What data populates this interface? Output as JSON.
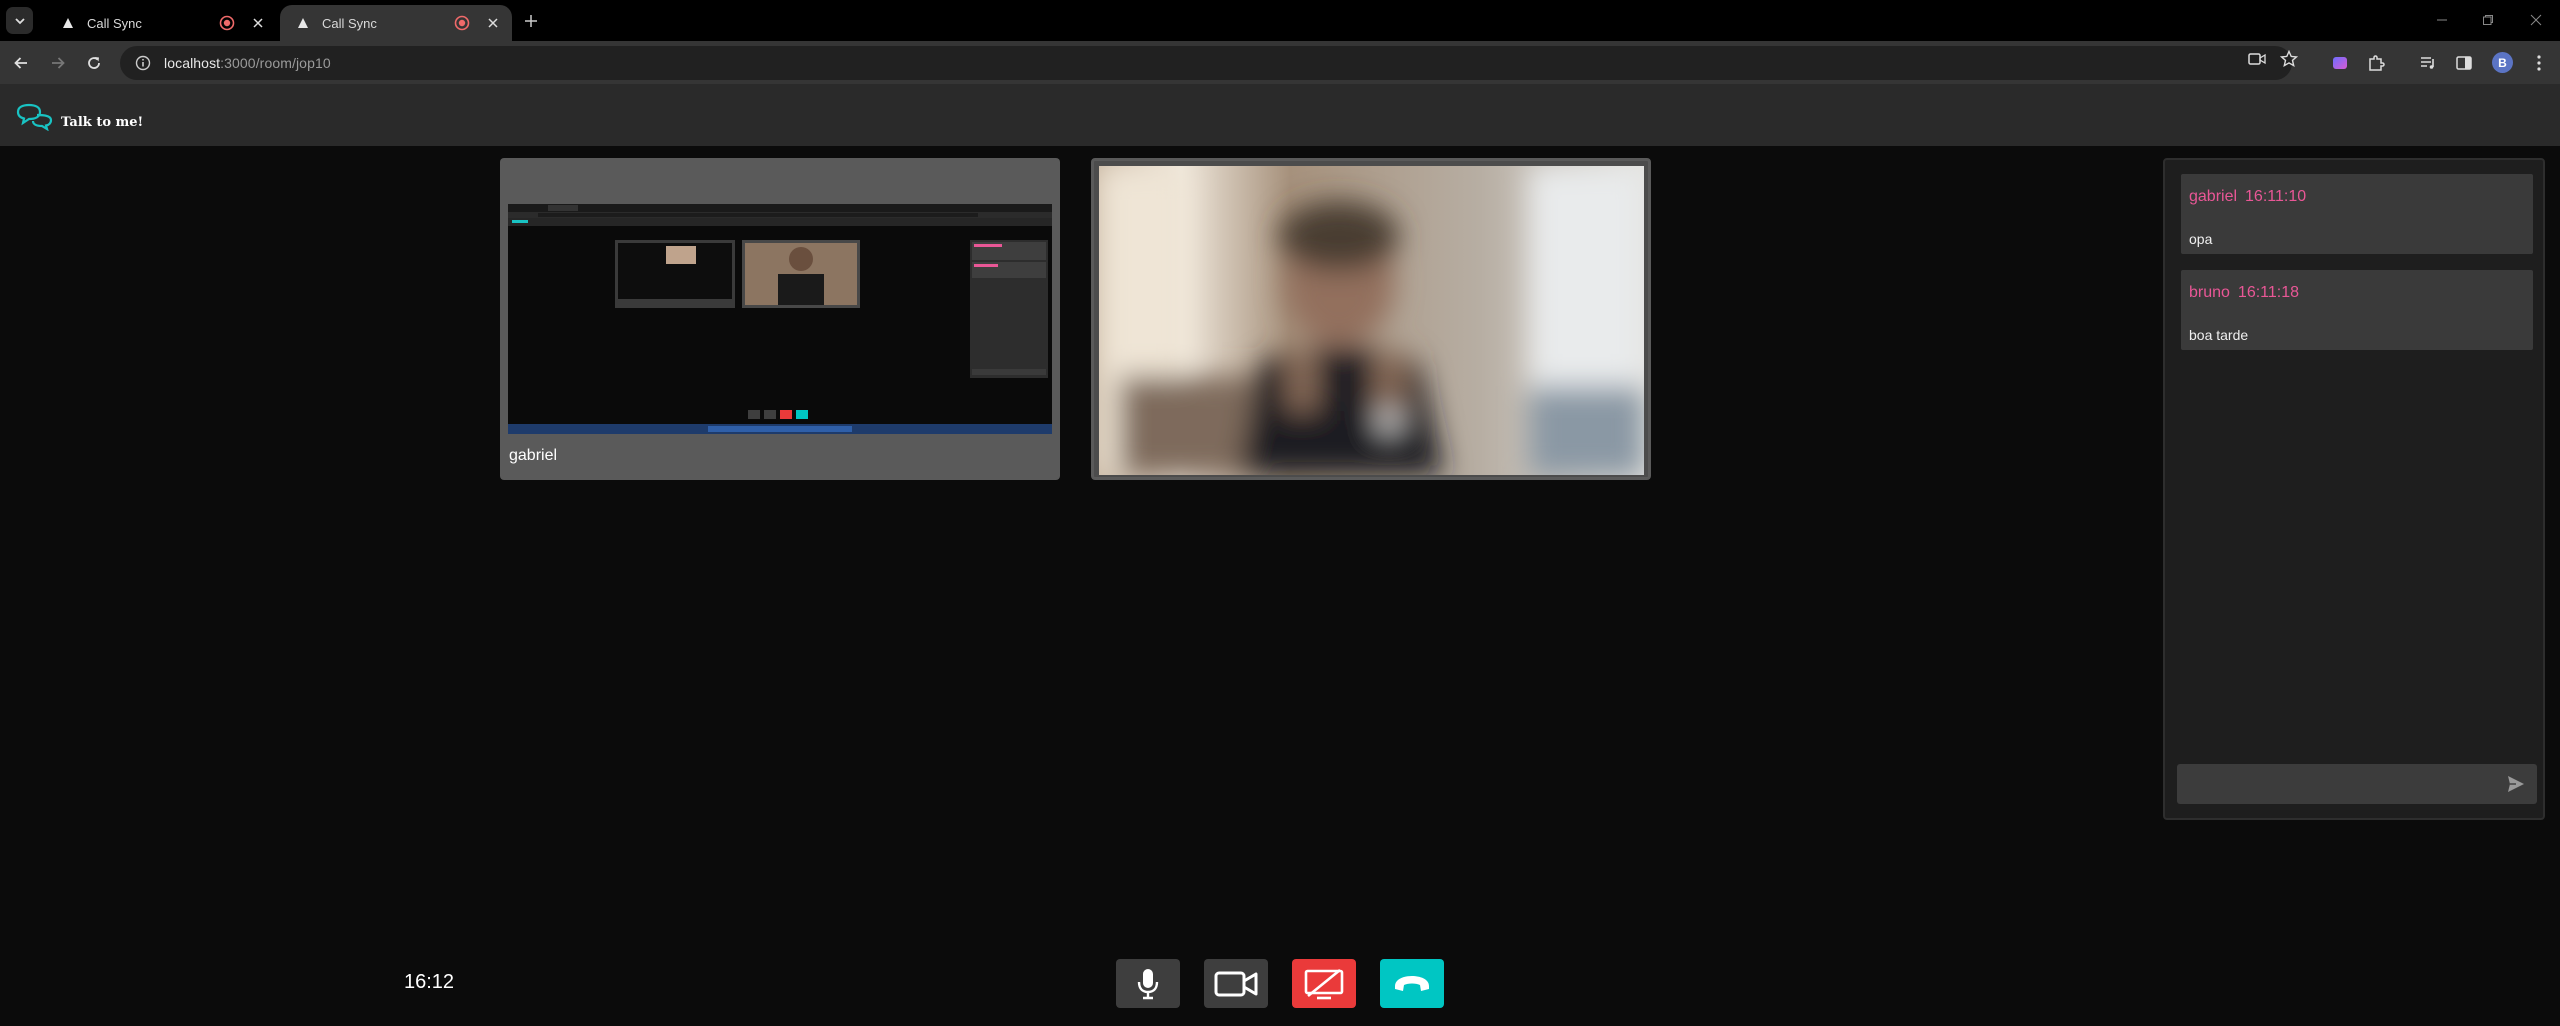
{
  "browser": {
    "tabs": [
      {
        "title": "Call Sync",
        "active": false
      },
      {
        "title": "Call Sync",
        "active": true
      }
    ],
    "url_host": "localhost",
    "url_rest": ":3000/room/jop10",
    "profile_initial": "B"
  },
  "app": {
    "logo_text": "Talk to me!",
    "accent": "#19c3c3"
  },
  "participants": [
    {
      "name": "gabriel",
      "type": "screen-share"
    },
    {
      "name": "",
      "type": "camera"
    }
  ],
  "chat": {
    "messages": [
      {
        "user": "gabriel",
        "time": "16:11:10",
        "text": "opa"
      },
      {
        "user": "bruno",
        "time": "16:11:18",
        "text": "boa tarde"
      }
    ],
    "input_placeholder": "",
    "name_color": "#e95796"
  },
  "controls": {
    "clock": "16:12",
    "buttons": [
      "microphone",
      "camera",
      "stop-screen-share",
      "hang-up"
    ]
  }
}
